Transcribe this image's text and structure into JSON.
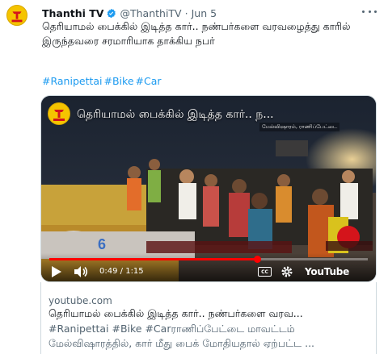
{
  "tweet": {
    "author": "Thanthi TV",
    "handle": "@ThanthiTV",
    "separator": "·",
    "date": "Jun 5",
    "avatar_logo_text": "THANTHI TV",
    "text": "தெரியாமல் பைக்கில் இடித்த கார்.. நண்பர்களை வரவழைத்து காரில் இருந்தவரை சரமாரியாக தாக்கிய நபர்",
    "hashtags": [
      "#Ranipettai",
      "#Bike",
      "#Car"
    ],
    "verified_icon": "verified-badge-icon",
    "more_icon": "more-dots-icon",
    "colors": {
      "link": "#1d9bf0",
      "muted": "#536471",
      "text": "#0f1419",
      "logo_yellow": "#f5c400",
      "logo_red": "#d4141b"
    }
  },
  "video": {
    "title": "தெரியாமல் பைக்கில் இடித்த கார்.. ந...",
    "overlay_caption": "மேல்விஷாரம், ராணிப்பேட்டை",
    "channel_number": "6",
    "time_current": "0:49",
    "time_separator": " / ",
    "time_total": "1:15",
    "progress_fraction": 0.653,
    "youtube_label": "YouTube",
    "cc_label": "CC",
    "icons": [
      "play-icon",
      "volume-icon",
      "cc-icon",
      "settings-icon",
      "youtube-logo"
    ]
  },
  "link_card": {
    "domain": "youtube.com",
    "title": "தெரியாமல் பைக்கில் இடித்த கார்.. நண்பர்களை வரவ...",
    "description_line1": "#Ranipettai #Bike #Carராணிப்பேட்டை மாவட்டம்",
    "description_line2": "மேல்விஷாரத்தில், கார் மீது பைக் மோதியதால் ஏற்பட்ட ..."
  }
}
